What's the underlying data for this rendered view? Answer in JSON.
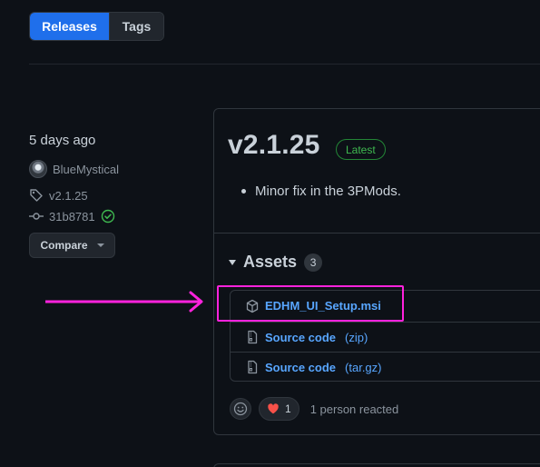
{
  "tabs": {
    "releases": "Releases",
    "tags": "Tags",
    "active": "releases"
  },
  "sidebar": {
    "time": "5 days ago",
    "author": "BlueMystical",
    "tag": "v2.1.25",
    "commit": "31b8781",
    "compare_label": "Compare"
  },
  "release": {
    "version": "v2.1.25",
    "badge": "Latest",
    "notes": [
      "Minor fix in the 3PMods."
    ],
    "assets_title": "Assets",
    "assets_count": "3",
    "assets": [
      {
        "name": "EDHM_UI_Setup.msi",
        "suffix": "",
        "icon": "package-icon"
      },
      {
        "name": "Source code",
        "suffix": "(zip)",
        "icon": "file-zip-icon"
      },
      {
        "name": "Source code",
        "suffix": "(tar.gz)",
        "icon": "file-zip-icon"
      }
    ],
    "reactions": {
      "heart_count": "1",
      "summary": "1 person reacted"
    }
  },
  "colors": {
    "background": "#0d1117",
    "accent": "#1f6feb",
    "link": "#58a6ff",
    "latest": "#3fb950",
    "annotation": "#ff22dd"
  }
}
